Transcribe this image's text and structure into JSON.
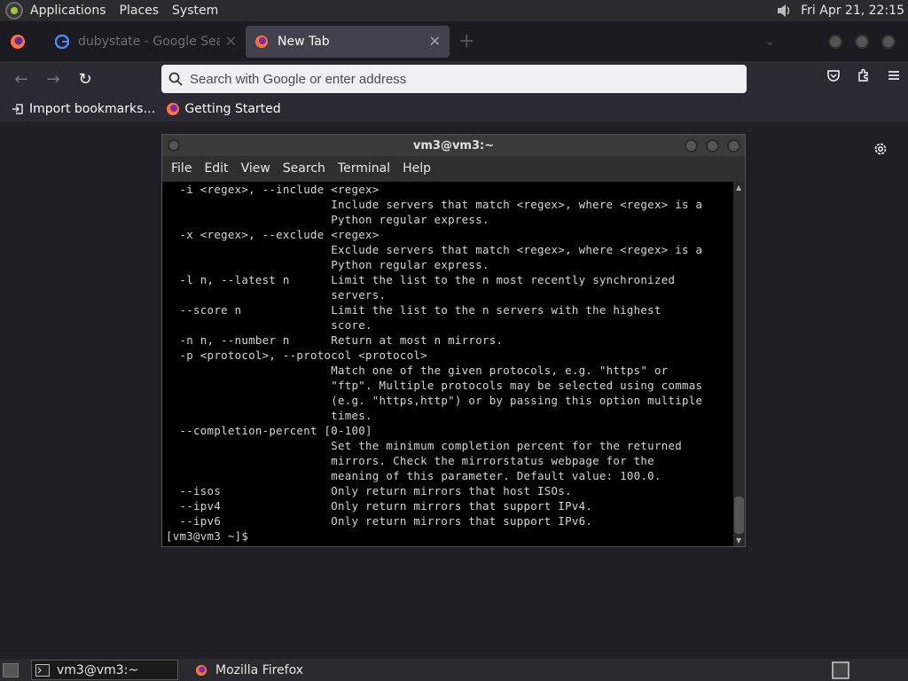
{
  "top_panel": {
    "menus": [
      "Applications",
      "Places",
      "System"
    ],
    "clock": "Fri Apr 21, 22:15"
  },
  "browser": {
    "tabs": [
      {
        "label": "dubystate - Google Search",
        "active": false
      },
      {
        "label": "New Tab",
        "active": true
      }
    ],
    "search_placeholder": "Search with Google or enter address",
    "bookmarks": [
      "Import bookmarks…",
      "Getting Started"
    ]
  },
  "terminal": {
    "title": "vm3@vm3:~",
    "menus": [
      "File",
      "Edit",
      "View",
      "Search",
      "Terminal",
      "Help"
    ],
    "lines": [
      "  -i <regex>, --include <regex>",
      "                        Include servers that match <regex>, where <regex> is a",
      "                        Python regular express.",
      "  -x <regex>, --exclude <regex>",
      "                        Exclude servers that match <regex>, where <regex> is a",
      "                        Python regular express.",
      "  -l n, --latest n      Limit the list to the n most recently synchronized",
      "                        servers.",
      "  --score n             Limit the list to the n servers with the highest",
      "                        score.",
      "  -n n, --number n      Return at most n mirrors.",
      "  -p <protocol>, --protocol <protocol>",
      "                        Match one of the given protocols, e.g. \"https\" or",
      "                        \"ftp\". Multiple protocols may be selected using commas",
      "                        (e.g. \"https,http\") or by passing this option multiple",
      "                        times.",
      "  --completion-percent [0-100]",
      "                        Set the minimum completion percent for the returned",
      "                        mirrors. Check the mirrorstatus webpage for the",
      "                        meaning of this parameter. Default value: 100.0.",
      "  --isos                Only return mirrors that host ISOs.",
      "  --ipv4                Only return mirrors that support IPv4.",
      "  --ipv6                Only return mirrors that support IPv6.",
      "[vm3@vm3 ~]$ "
    ]
  },
  "taskbar": {
    "tasks": [
      {
        "label": "vm3@vm3:~",
        "active": true
      },
      {
        "label": "Mozilla Firefox",
        "active": false
      }
    ]
  },
  "colors": {
    "terminal_bg": "#000000",
    "terminal_fg": "#d6d6d6",
    "browser_chrome": "#2b2a33",
    "panel": "#2b2b2f"
  }
}
